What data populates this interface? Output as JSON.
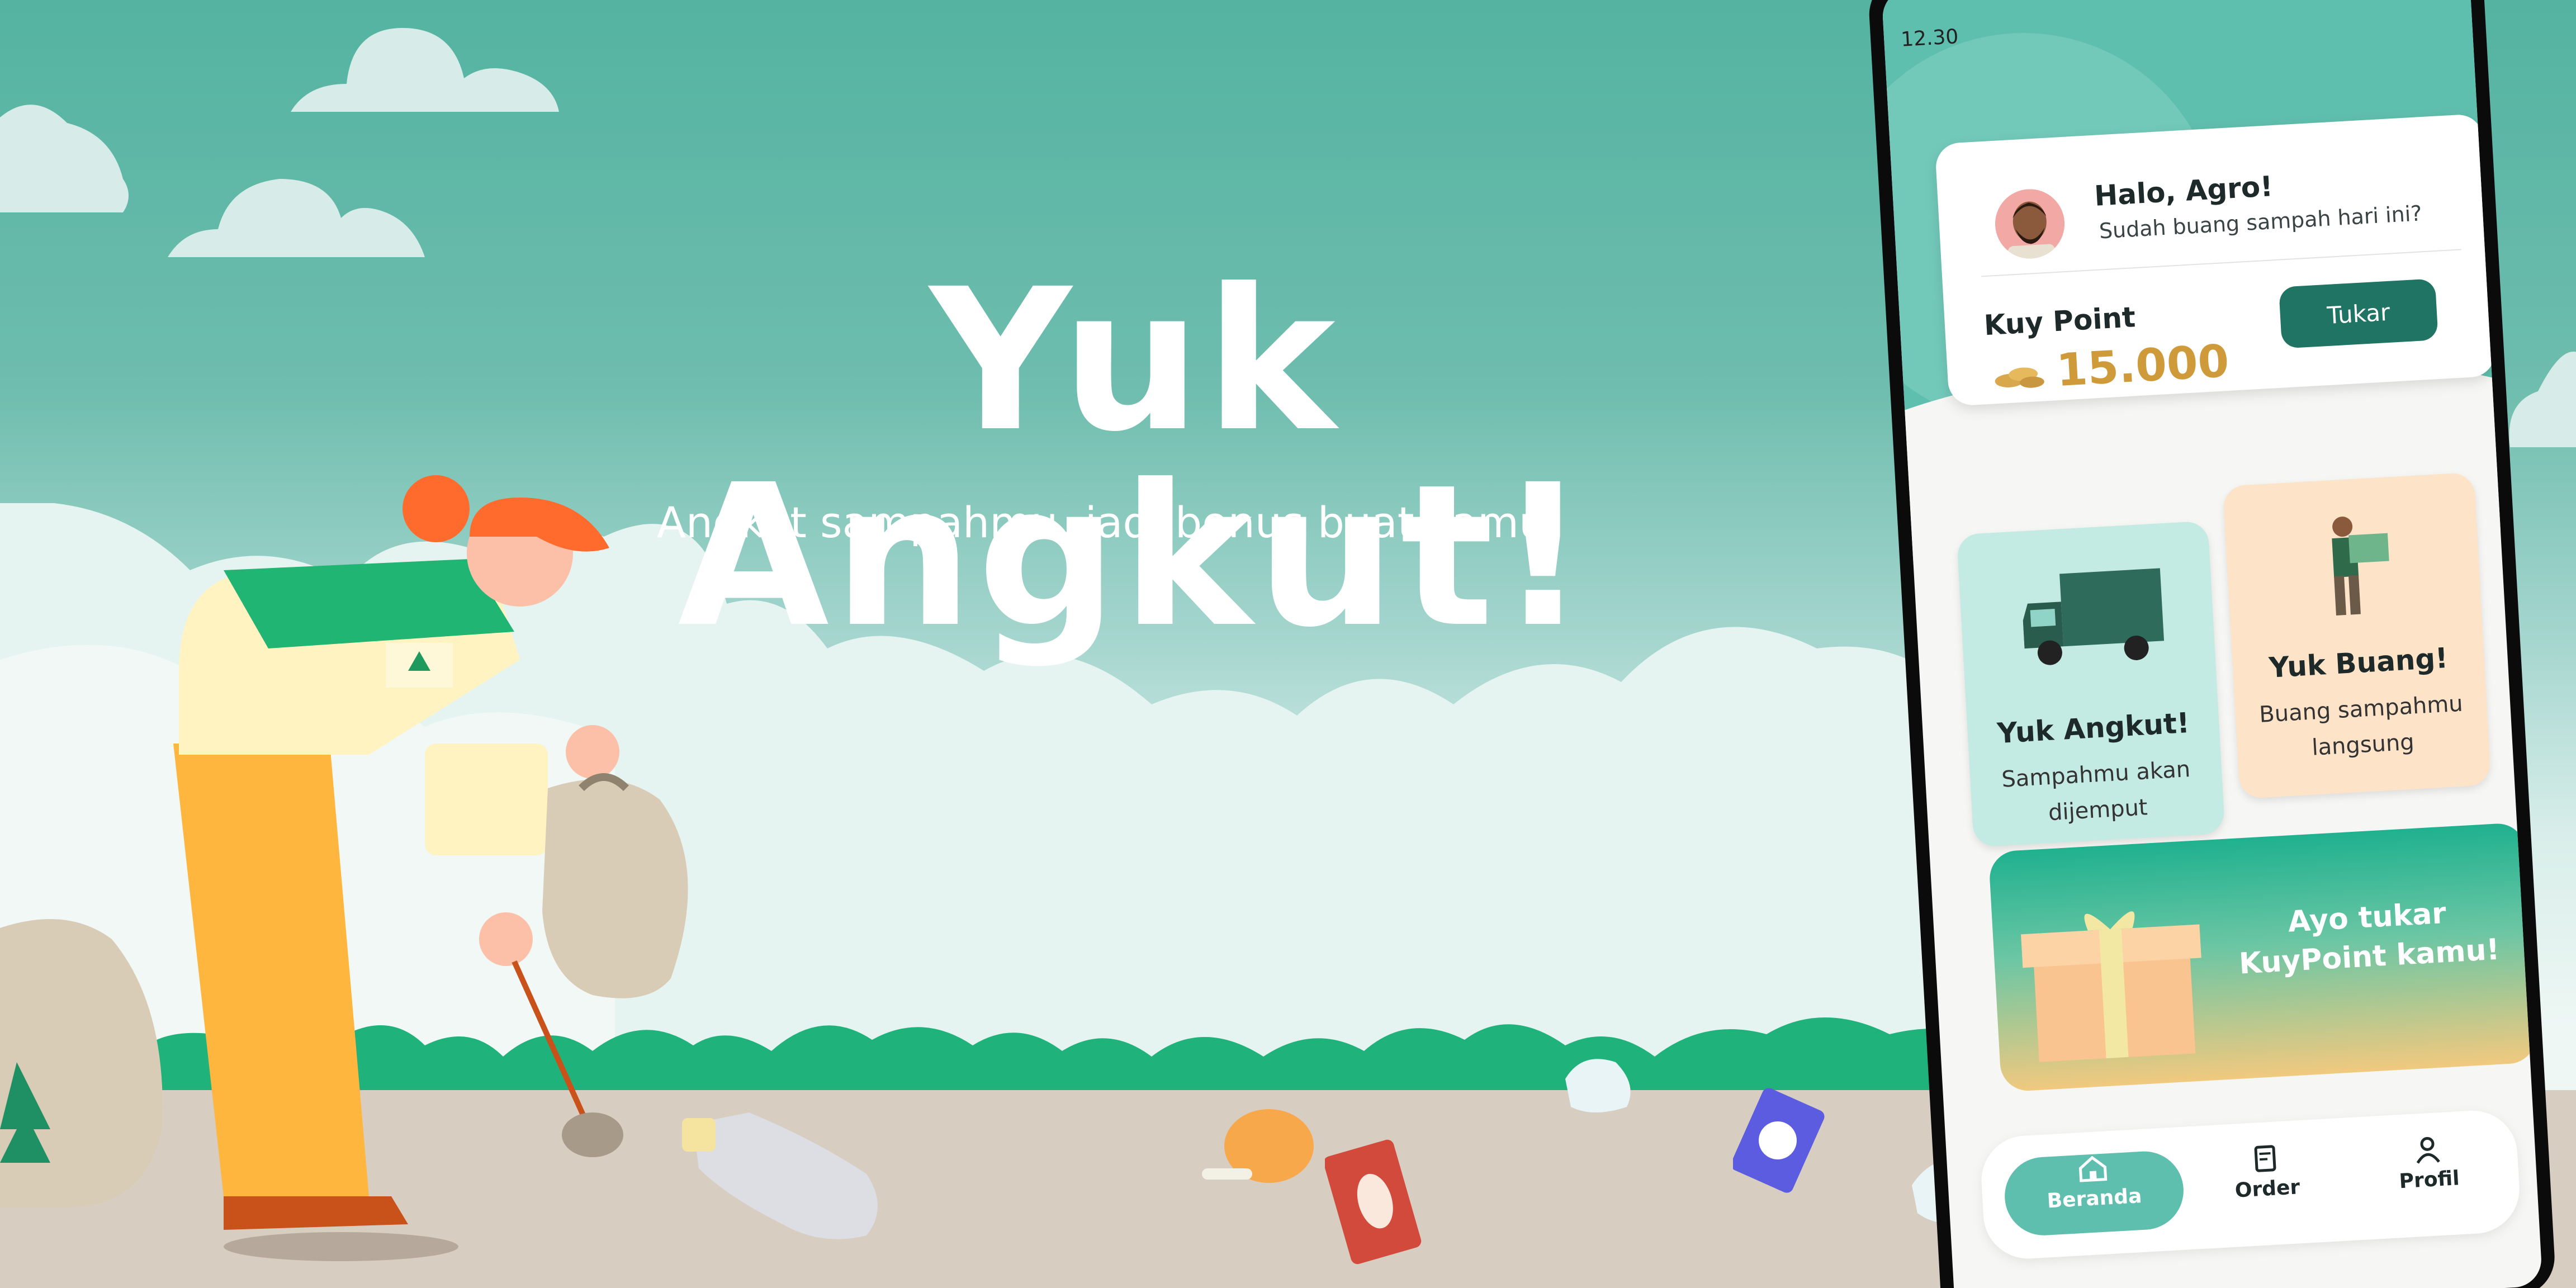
{
  "hero": {
    "title": "Yuk Angkut!",
    "subtitle": "Angkut sampahmu, jadi bonus buat kamu"
  },
  "phone": {
    "status_time": "12.30",
    "greeting": "Halo, Agro!",
    "greeting_sub": "Sudah buang sampah hari ini?",
    "points_label": "Kuy Point",
    "points_value": "15.000",
    "redeem_button": "Tukar",
    "tiles": [
      {
        "title": "Yuk Angkut!",
        "desc_line1": "Sampahmu akan",
        "desc_line2": "dijemput"
      },
      {
        "title": "Yuk Buang!",
        "desc_line1": "Buang sampahmu",
        "desc_line2": "langsung"
      }
    ],
    "promo_line1": "Ayo tukar",
    "promo_line2": "KuyPoint kamu!",
    "nav": [
      {
        "label": "Beranda",
        "icon": "home-icon",
        "active": true
      },
      {
        "label": "Order",
        "icon": "order-icon",
        "active": false
      },
      {
        "label": "Profil",
        "icon": "profile-icon",
        "active": false
      }
    ]
  },
  "colors": {
    "sky_top": "#54b3a1",
    "brand_dark": "#1f7464",
    "brand": "#5fbfae",
    "points": "#cf9a39",
    "tile_green": "#c3ebe3",
    "tile_peach": "#fde3c8"
  }
}
